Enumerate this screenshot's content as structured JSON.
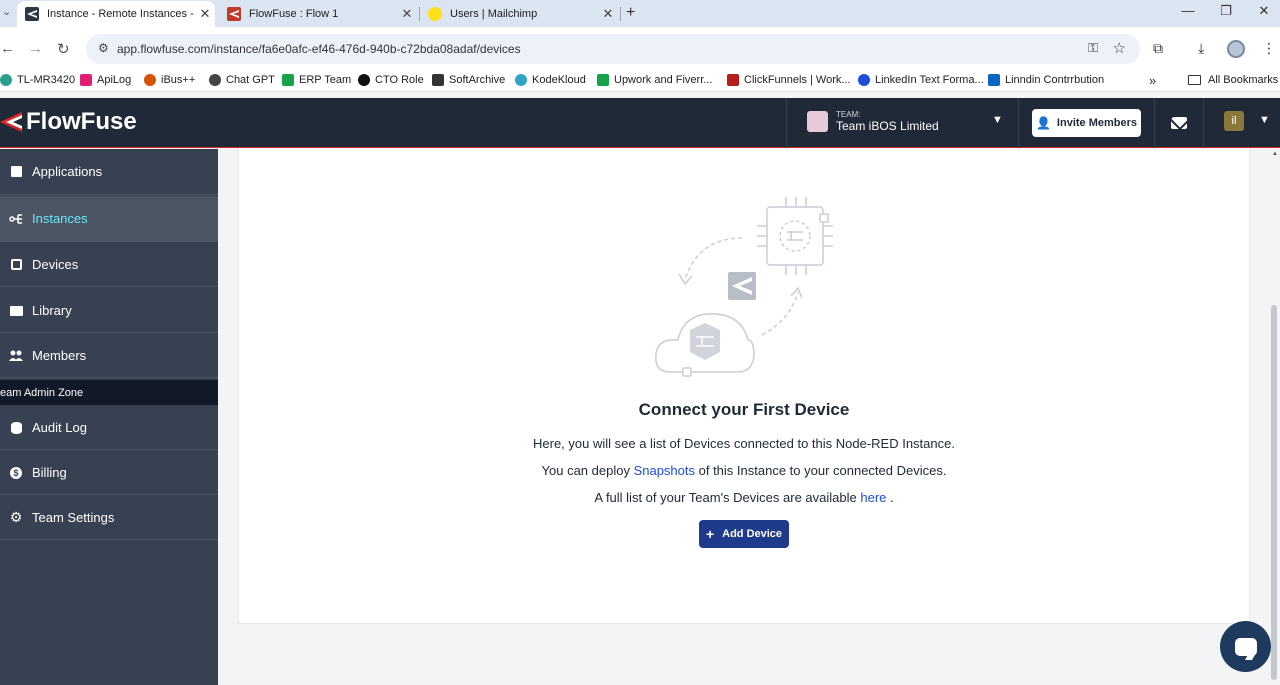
{
  "browser": {
    "tabs": [
      {
        "title": "Instance - Remote Instances - F",
        "favicon": "flowfuse-icon",
        "active": true
      },
      {
        "title": "FlowFuse : Flow 1",
        "favicon": "flowfuse-icon",
        "active": false
      },
      {
        "title": "Users | Mailchimp",
        "favicon": "mailchimp-icon",
        "active": false
      }
    ],
    "url": "app.flowfuse.com/instance/fa6e0afc-ef46-476d-940b-c72bda08adaf/devices",
    "bookmarks": [
      "TL-MR3420",
      "ApiLog",
      "iBus++",
      "Chat GPT",
      "ERP Team",
      "CTO Role",
      "SoftArchive",
      "KodeKloud",
      "Upwork and Fiverr...",
      "ClickFunnels | Work...",
      "LinkedIn Text Forma...",
      "Linndin Contrrbution"
    ],
    "bookmarks_more": "»",
    "all_bookmarks": "All Bookmarks"
  },
  "header": {
    "brand": "FlowFuse",
    "team_label": "TEAM:",
    "team_name": "Team iBOS Limited",
    "invite_label": "Invite Members",
    "user_initial": "il"
  },
  "sidebar": {
    "items_top": [
      {
        "label": "Applications",
        "icon": "applications-icon"
      },
      {
        "label": "Instances",
        "icon": "instances-icon",
        "active": true
      },
      {
        "label": "Devices",
        "icon": "devices-icon"
      },
      {
        "label": "Library",
        "icon": "library-icon"
      },
      {
        "label": "Members",
        "icon": "members-icon"
      }
    ],
    "zone_label": "eam Admin Zone",
    "items_bottom": [
      {
        "label": "Audit Log",
        "icon": "audit-log-icon"
      },
      {
        "label": "Billing",
        "icon": "billing-icon"
      },
      {
        "label": "Team Settings",
        "icon": "gear-icon"
      }
    ]
  },
  "empty_state": {
    "title": "Connect your First Device",
    "line1": "Here, you will see a list of Devices connected to this Node-RED Instance.",
    "line2_pre": "You can deploy ",
    "line2_link": "Snapshots",
    "line2_post": " of this Instance to your connected Devices.",
    "line3_pre": "A full list of your Team's Devices are available ",
    "line3_link": "here",
    "line3_post": " .",
    "button": "Add Device"
  },
  "colors": {
    "header_bg": "#1f2937",
    "sidebar_bg": "#374151",
    "accent_active": "#67e8f9",
    "primary_button": "#1e3a8a",
    "brand_red": "#dc2626"
  }
}
